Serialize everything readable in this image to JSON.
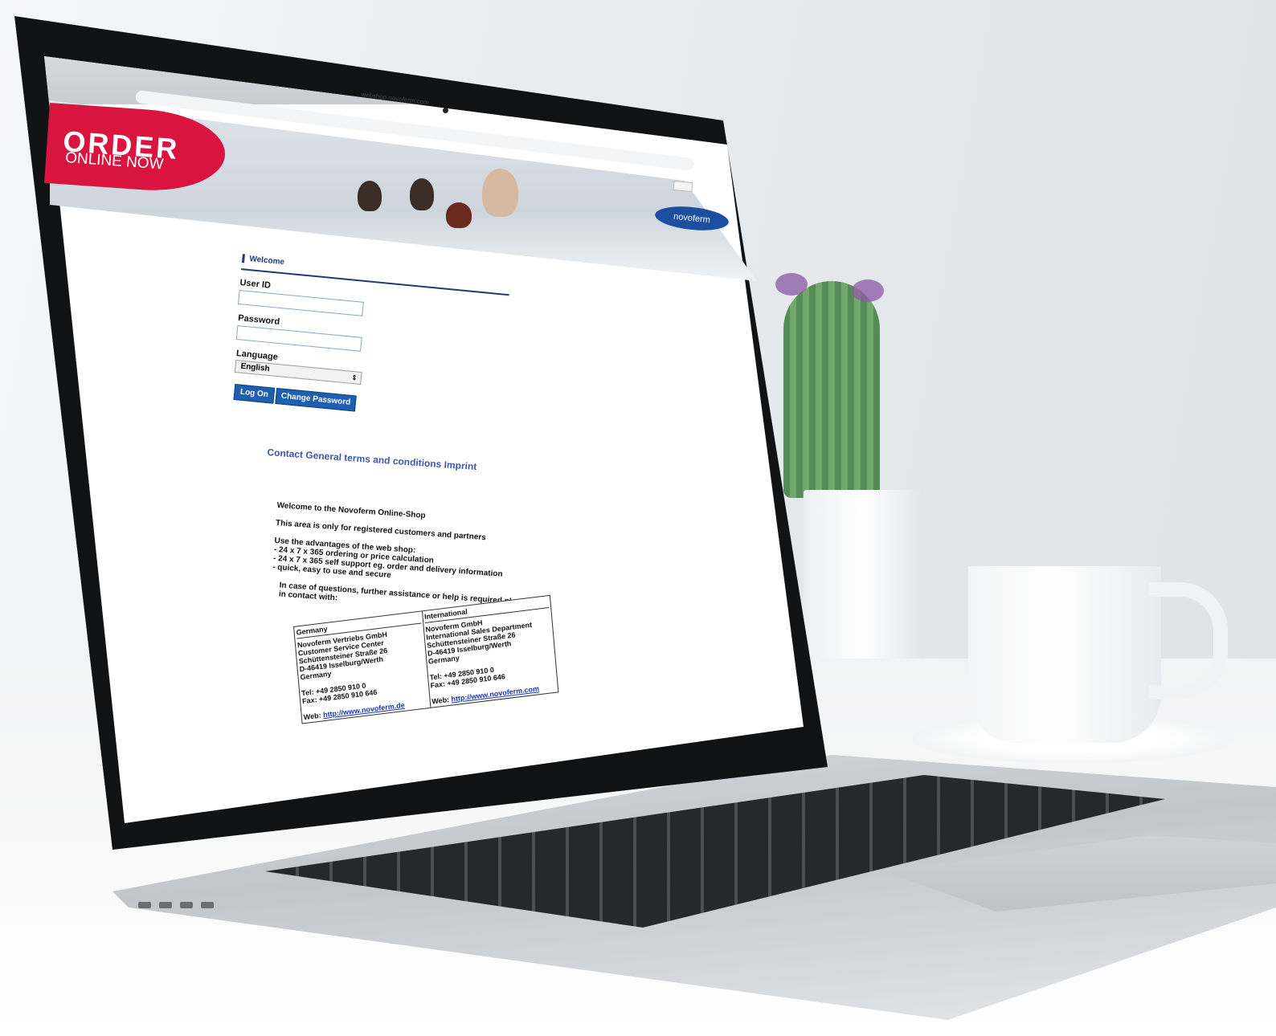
{
  "browser": {
    "address": "webshop.novoferm.com"
  },
  "banner": {
    "order_title": "ORDER",
    "order_subtitle": "ONLINE NOW",
    "logo_text": "novoferm"
  },
  "login": {
    "section_title": "Welcome",
    "user_id_label": "User ID",
    "user_id_value": "",
    "password_label": "Password",
    "password_value": "",
    "language_label": "Language",
    "language_selected": "English",
    "log_on_button": "Log On",
    "change_password_button": "Change Password"
  },
  "footer_links": {
    "contact": "Contact",
    "terms": "General terms and conditions",
    "imprint": "Imprint"
  },
  "info": {
    "welcome": "Welcome to the Novoferm Online-Shop",
    "registered": "This area is only for registered customers and partners",
    "advantages_title": "Use the advantages of the web shop:",
    "advantages": [
      "- 24 x 7 x 365 ordering or price calculation",
      "- 24 x 7 x 365 self support eg. order and delivery information",
      "- quick, easy to use and secure"
    ],
    "questions": "In case of questions, further assistance or help is required please get in contact with:"
  },
  "contacts": {
    "germany": {
      "heading": "Germany",
      "lines": [
        "Novoferm Vertriebs GmbH",
        "Customer Service Center",
        "Schüttensteiner Straße 26",
        "D-46419 Isselburg/Werth",
        "Germany",
        "",
        "Tel: +49 2850 910 0",
        "Fax: +49 2850 910 646",
        ""
      ],
      "web_label": "Web:",
      "web_link": "http://www.novoferm.de"
    },
    "international": {
      "heading": "International",
      "lines": [
        "Novoferm GmbH",
        "International Sales Department",
        "Schüttensteiner Straße 26",
        "D-46419 Isselburg/Werth",
        "Germany",
        "",
        "Tel: +49 2850 910 0",
        "Fax: +49 2850 910 646"
      ],
      "web_label": "Web:",
      "web_link": "http://www.novoferm.com"
    }
  },
  "colors": {
    "brand_red": "#d9143f",
    "brand_blue": "#1c4fa1",
    "button_blue": "#1f5fb0",
    "link_blue": "#3c58a8"
  }
}
